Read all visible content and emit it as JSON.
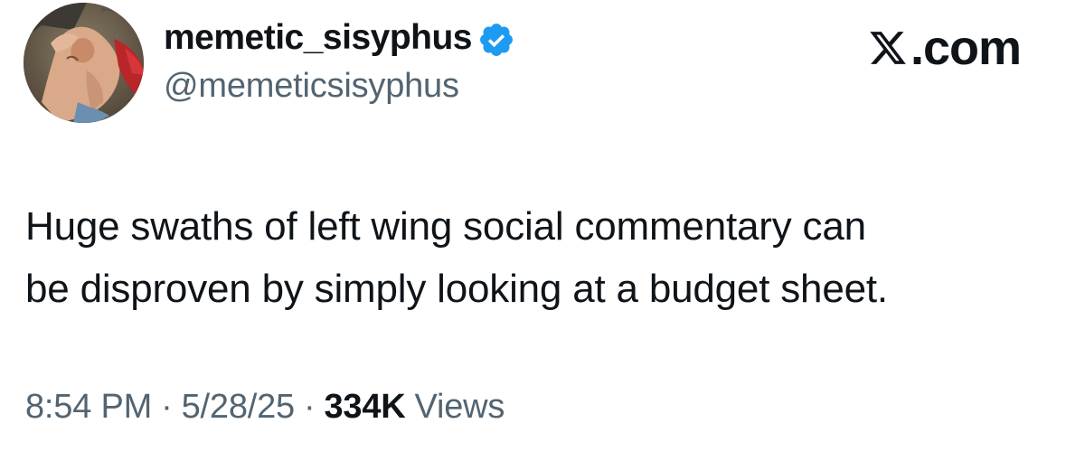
{
  "author": {
    "display_name": "memetic_sisyphus",
    "handle": "@memeticsisyphus",
    "verified": true,
    "verified_color": "#1d9bf0"
  },
  "brand": {
    "text": ".com",
    "icon": "x-logo-icon"
  },
  "tweet": {
    "lines": [
      "Huge swaths of left wing social commentary can",
      "be disproven by simply looking at a budget sheet."
    ]
  },
  "meta": {
    "time": "8:54 PM",
    "separator": "·",
    "date": "5/28/25",
    "views_count": "334K",
    "views_label": "Views"
  },
  "colors": {
    "text": "#0f1419",
    "secondary": "#536471"
  }
}
